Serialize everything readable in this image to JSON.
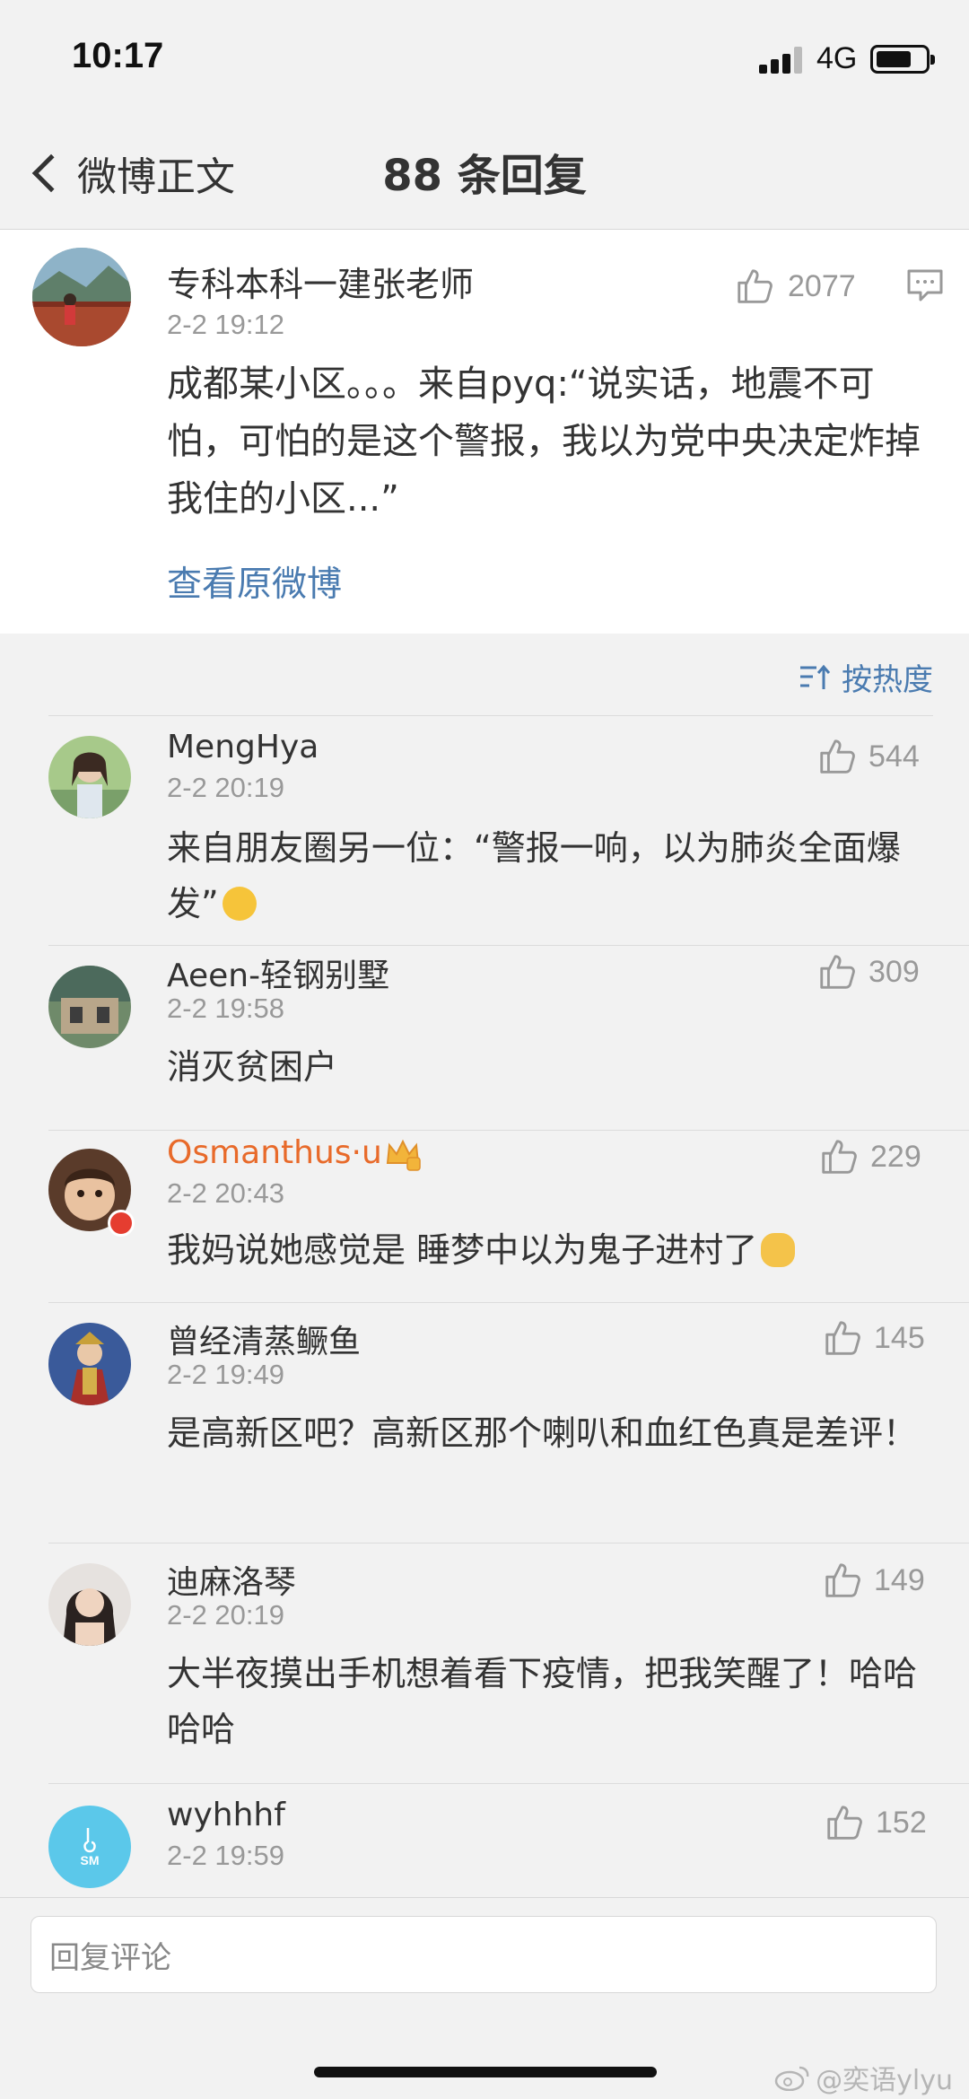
{
  "status_bar": {
    "time": "10:17",
    "network": "4G",
    "battery_level": 0.7
  },
  "nav": {
    "back_label": "微博正文",
    "title": "88 条回复"
  },
  "post": {
    "author": "专科本科一建张老师",
    "time": "2-2 19:12",
    "likes": "2077",
    "text": "成都某小区。。。来自pyq:“说实话，地震不可怕，可怕的是这个警报，我以为党中央决定炸掉我住的小区...”",
    "view_original": "查看原微博"
  },
  "sort": {
    "label": "按热度",
    "icon": "sort-icon"
  },
  "comments": [
    {
      "name": "MengHya",
      "time": "2-2 20:19",
      "likes": "544",
      "text": "来自朋友圈另一位：“警报一响，以为肺炎全面爆发”",
      "emoji": "crying-laugh-emoji"
    },
    {
      "name": "Aeen-轻钢别墅",
      "time": "2-2 19:58",
      "likes": "309",
      "text": "消灭贫困户"
    },
    {
      "name": "Osmanthus·u",
      "time": "2-2 20:43",
      "likes": "229",
      "text": "我妈说她感觉是 睡梦中以为鬼子进村了",
      "emoji": "sweat-emoji",
      "vip": true
    },
    {
      "name": "曾经清蒸鳜鱼",
      "time": "2-2 19:49",
      "likes": "145",
      "text": "是高新区吧？高新区那个喇叭和血红色真是差评！"
    },
    {
      "name": "迪麻洛琴",
      "time": "2-2 20:19",
      "likes": "149",
      "text": "大半夜摸出手机想着看下疫情，把我笑醒了！哈哈哈哈"
    },
    {
      "name": "wyhhhf",
      "time": "2-2 19:59",
      "likes": "152",
      "avatar_text": "SM"
    }
  ],
  "footer": {
    "reply_placeholder": "回复评论",
    "watermark": "@奕语ylyu"
  },
  "colors": {
    "link": "#4a7bb0",
    "vip_name": "#e86a2a",
    "background": "#f2f2f2"
  }
}
